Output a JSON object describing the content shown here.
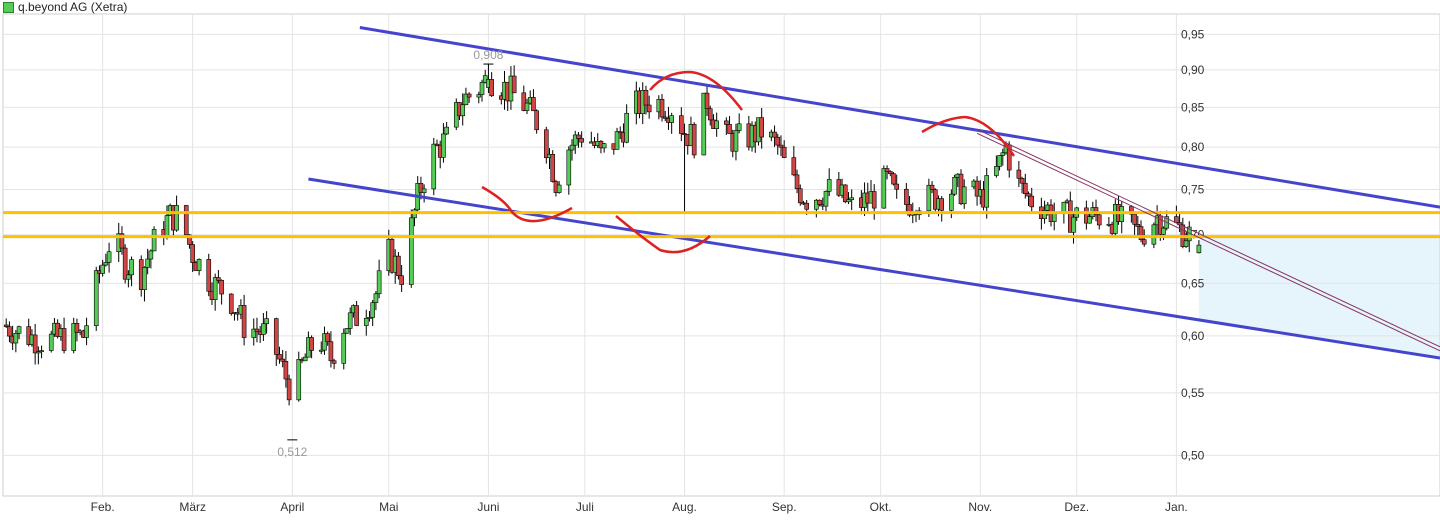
{
  "legend": {
    "label": "q.beyond AG (Xetra)",
    "swatch_color": "#55cc55"
  },
  "colors": {
    "up": "#55cc55",
    "down": "#d24545",
    "channel": "#4444cc",
    "support": "#ffc000",
    "annotation": "#dd2222",
    "zone": "#e6f4fb",
    "grid": "#e4e4e4"
  },
  "chart_data": {
    "type": "candlestick",
    "title": "q.beyond AG (Xetra)",
    "y_scale": "log",
    "ylim": [
      0.47,
      0.98
    ],
    "y_ticks": [
      "0,95",
      "0,90",
      "0,85",
      "0,80",
      "0,75",
      "0,70",
      "0,65",
      "0,60",
      "0,55",
      "0,50"
    ],
    "x_labels": [
      {
        "label": "Feb.",
        "day": 23
      },
      {
        "label": "März",
        "day": 51
      },
      {
        "label": "April",
        "day": 82
      },
      {
        "label": "Mai",
        "day": 112
      },
      {
        "label": "Juni",
        "day": 143
      },
      {
        "label": "Juli",
        "day": 173
      },
      {
        "label": "Aug.",
        "day": 204
      },
      {
        "label": "Sep.",
        "day": 235
      },
      {
        "label": "Okt.",
        "day": 265
      },
      {
        "label": "Nov.",
        "day": 296
      },
      {
        "label": "Dez.",
        "day": 326
      },
      {
        "label": "Jan.",
        "day": 357
      }
    ],
    "x_range_days": [
      -8,
      439
    ],
    "annotations": [
      {
        "text": "0,908",
        "day": 143,
        "value": 0.908,
        "position": "above"
      },
      {
        "text": "0,512",
        "day": 82,
        "value": 0.512,
        "position": "below"
      }
    ],
    "horizontal_lines": [
      0.724,
      0.698
    ],
    "channel_upper": [
      [
        103,
        0.96
      ],
      [
        439,
        0.73
      ]
    ],
    "channel_lower": [
      [
        87,
        0.762
      ],
      [
        439,
        0.58
      ]
    ],
    "thin_trend": [
      [
        295,
        0.822
      ],
      [
        439,
        0.59
      ]
    ],
    "shaded_zone_top": 0.698,
    "anchors": [
      [
        -8,
        0.61
      ],
      [
        0,
        0.6
      ],
      [
        5,
        0.595
      ],
      [
        12,
        0.6
      ],
      [
        17,
        0.6
      ],
      [
        22,
        0.66
      ],
      [
        26,
        0.7
      ],
      [
        30,
        0.67
      ],
      [
        35,
        0.66
      ],
      [
        40,
        0.7
      ],
      [
        44,
        0.72
      ],
      [
        47,
        0.72
      ],
      [
        51,
        0.68
      ],
      [
        57,
        0.65
      ],
      [
        62,
        0.64
      ],
      [
        67,
        0.61
      ],
      [
        75,
        0.6
      ],
      [
        79,
        0.57
      ],
      [
        82,
        0.55
      ],
      [
        86,
        0.58
      ],
      [
        90,
        0.6
      ],
      [
        94,
        0.58
      ],
      [
        98,
        0.61
      ],
      [
        103,
        0.62
      ],
      [
        108,
        0.64
      ],
      [
        112,
        0.68
      ],
      [
        116,
        0.66
      ],
      [
        121,
        0.74
      ],
      [
        125,
        0.79
      ],
      [
        130,
        0.81
      ],
      [
        135,
        0.86
      ],
      [
        139,
        0.87
      ],
      [
        143,
        0.89
      ],
      [
        150,
        0.87
      ],
      [
        155,
        0.85
      ],
      [
        160,
        0.82
      ],
      [
        164,
        0.76
      ],
      [
        168,
        0.8
      ],
      [
        173,
        0.82
      ],
      [
        178,
        0.79
      ],
      [
        183,
        0.81
      ],
      [
        188,
        0.85
      ],
      [
        194,
        0.86
      ],
      [
        200,
        0.85
      ],
      [
        204,
        0.82
      ],
      [
        207,
        0.81
      ],
      [
        211,
        0.86
      ],
      [
        216,
        0.81
      ],
      [
        222,
        0.81
      ],
      [
        228,
        0.82
      ],
      [
        233,
        0.8
      ],
      [
        237,
        0.76
      ],
      [
        242,
        0.74
      ],
      [
        250,
        0.75
      ],
      [
        256,
        0.73
      ],
      [
        262,
        0.74
      ],
      [
        267,
        0.76
      ],
      [
        271,
        0.73
      ],
      [
        276,
        0.74
      ],
      [
        281,
        0.74
      ],
      [
        287,
        0.75
      ],
      [
        291,
        0.75
      ],
      [
        296,
        0.74
      ],
      [
        300,
        0.76
      ],
      [
        304,
        0.8
      ],
      [
        307,
        0.76
      ],
      [
        311,
        0.74
      ],
      [
        316,
        0.73
      ],
      [
        321,
        0.72
      ],
      [
        328,
        0.72
      ],
      [
        336,
        0.72
      ],
      [
        342,
        0.71
      ],
      [
        346,
        0.7
      ],
      [
        351,
        0.72
      ],
      [
        356,
        0.71
      ],
      [
        361,
        0.7
      ],
      [
        364,
        0.685
      ]
    ]
  }
}
